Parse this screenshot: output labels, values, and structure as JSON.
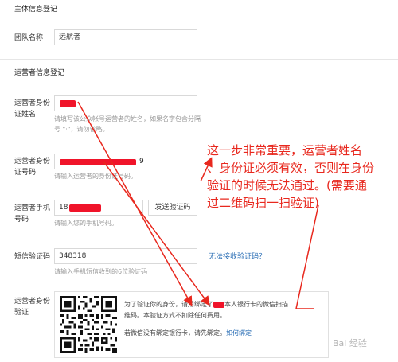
{
  "sections": {
    "entity": "主体信息登记",
    "operator": "运营者信息登记"
  },
  "team": {
    "label": "团队名称",
    "value": "远航者"
  },
  "operator_name": {
    "label_line1": "运营者身份",
    "label_line2": "证姓名",
    "hint_line1": "请填写该公众帐号运营者的姓名，如果名字包含分隔",
    "hint_line2": "号 \"·\"，请勿省略。"
  },
  "operator_id": {
    "label_line1": "运营者身份",
    "label_line2": "证号码",
    "value_tail": "9",
    "hint": "请输入运营者的身份证号码。"
  },
  "operator_phone": {
    "label_line1": "运营者手机",
    "label_line2": "号码",
    "value_prefix": "18",
    "send_button": "发送验证码",
    "hint": "请输入您的手机号码。"
  },
  "sms": {
    "label": "短信验证码",
    "value": "348318",
    "cant_receive_link": "无法接收验证码？",
    "hint": "请输入手机短信收到的6位验证码"
  },
  "verify": {
    "label_line1": "运营者身份",
    "label_line2": "验证",
    "text_line1_a": "为了验证你的身份，请用绑定了",
    "text_line1_b": "本人银行卡的微信扫描二",
    "text_line2": "维码。本验证方式不扣除任何费用。",
    "no_bank_text": "若微信没有绑定银行卡，请先绑定。",
    "how_to_bind_link": "如何绑定"
  },
  "annotation": {
    "line1": "这一步非常重要，运营者姓名",
    "line2": "、身份证必须有效，否则在身份",
    "line3": "验证的时候无法通过。(需要通",
    "line4": "过二维码扫一扫验证)"
  },
  "watermark": "Bai 经验",
  "colors": {
    "annotation": "#e8281e",
    "link": "#2a6eb5",
    "redaction": "#f0142a"
  }
}
